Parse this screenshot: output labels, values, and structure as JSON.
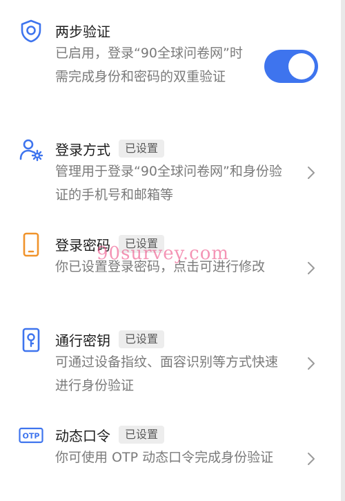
{
  "accent_color": "#3e74ee",
  "phone_icon_color": "#f0932b",
  "items": [
    {
      "title": "两步验证",
      "badge": "",
      "description": "已启用，登录“90全球问卷网”时需完成身份和密码的双重验证",
      "icon": "shield-icon",
      "toggle_on": true
    },
    {
      "title": "登录方式",
      "badge": "已设置",
      "description": "管理用于登录“90全球问卷网”和身份验证的手机号和邮箱等",
      "icon": "user-gear-icon"
    },
    {
      "title": "登录密码",
      "badge": "已设置",
      "description": "你已设置登录密码，点击可进行修改",
      "icon": "phone-icon"
    },
    {
      "title": "通行密钥",
      "badge": "已设置",
      "description": "可通过设备指纹、面容识别等方式快速进行身份验证",
      "icon": "passkey-icon"
    },
    {
      "title": "动态口令",
      "badge": "已设置",
      "description": "你可使用 OTP 动态口令完成身份验证",
      "icon": "otp-icon",
      "icon_text": "OTP"
    }
  ],
  "watermark": "90survey.com"
}
